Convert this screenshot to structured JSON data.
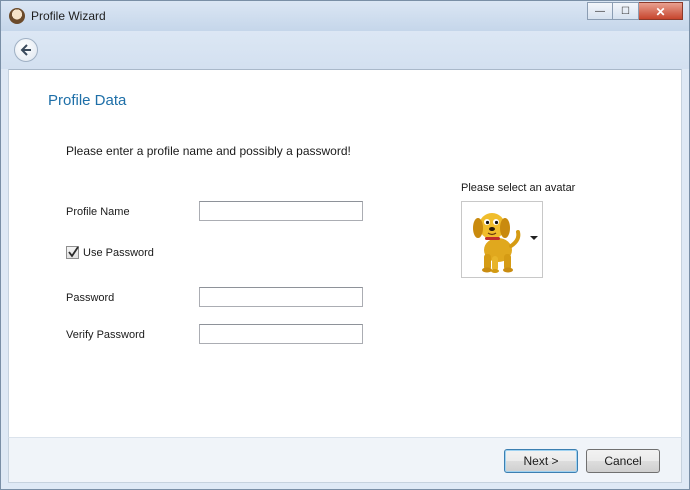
{
  "window": {
    "title": "Profile Wizard"
  },
  "titlebar": {
    "minimize_glyph": "—",
    "maximize_glyph": "☐",
    "close_glyph": "✕"
  },
  "page": {
    "title": "Profile Data",
    "instruction": "Please enter a profile name and possibly a password!"
  },
  "form": {
    "profile_name_label": "Profile Name",
    "profile_name_value": "",
    "use_password_label": "Use Password",
    "use_password_checked": true,
    "password_label": "Password",
    "password_value": "",
    "verify_password_label": "Verify Password",
    "verify_password_value": ""
  },
  "avatar": {
    "label": "Please select an avatar",
    "selected": "dog-avatar"
  },
  "footer": {
    "next_label": "Next >",
    "cancel_label": "Cancel"
  },
  "colors": {
    "accent": "#1e6fa8",
    "titlebar": "#c5d6ea",
    "window_frame": "#dfe9f5"
  }
}
